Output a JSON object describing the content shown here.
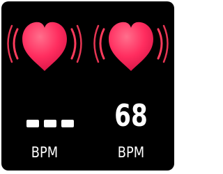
{
  "colors": {
    "background": "#000000",
    "heart": "#ff2d5f",
    "waves": "#ff3b5c",
    "text": "#ffffff"
  },
  "icons": {
    "left": "heart-pulse-icon",
    "right": "heart-pulse-icon"
  },
  "left_panel": {
    "value_placeholder": "---",
    "unit": "BPM"
  },
  "right_panel": {
    "value": "68",
    "unit": "BPM"
  }
}
